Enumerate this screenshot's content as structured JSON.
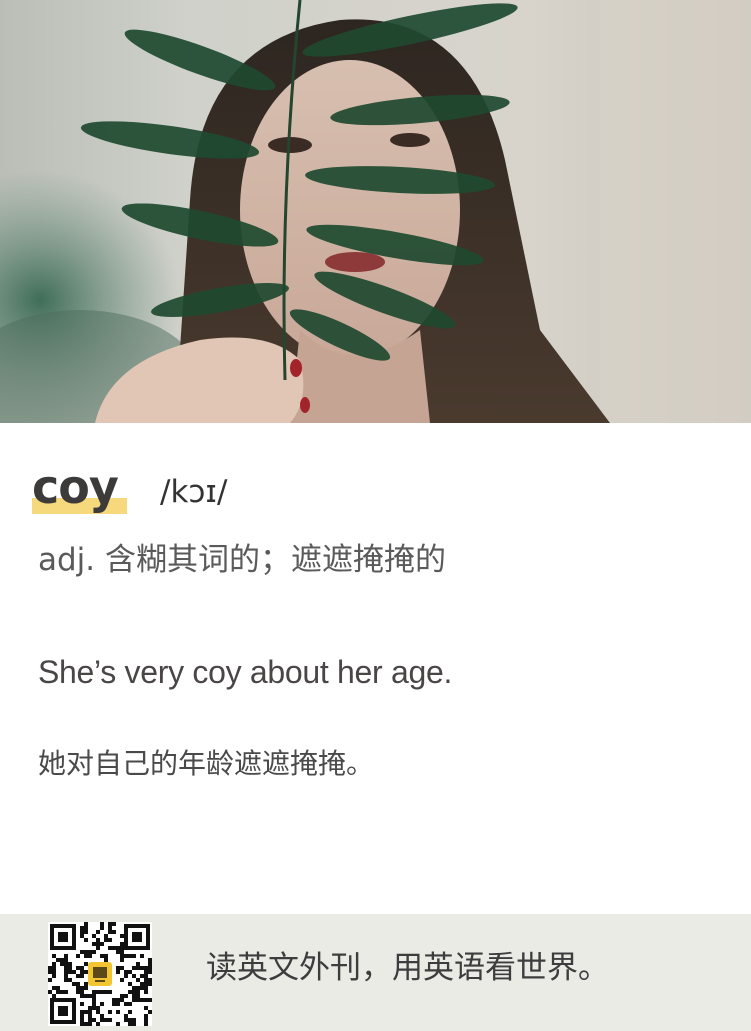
{
  "entry": {
    "headword": "coy",
    "phonetic": "/kɔɪ/",
    "definition": "adj. 含糊其词的；遮遮掩掩的",
    "example": "She’s very coy about her age.",
    "example_translation": "她对自己的年龄遮遮掩掩。"
  },
  "footer": {
    "slogan": "读英文外刊，用英语看世界。",
    "qr_icon": "qr-code-icon"
  },
  "colors": {
    "highlight": "#f5d97c",
    "footer_bg": "#ebebe6",
    "text": "#3d3a3a"
  }
}
